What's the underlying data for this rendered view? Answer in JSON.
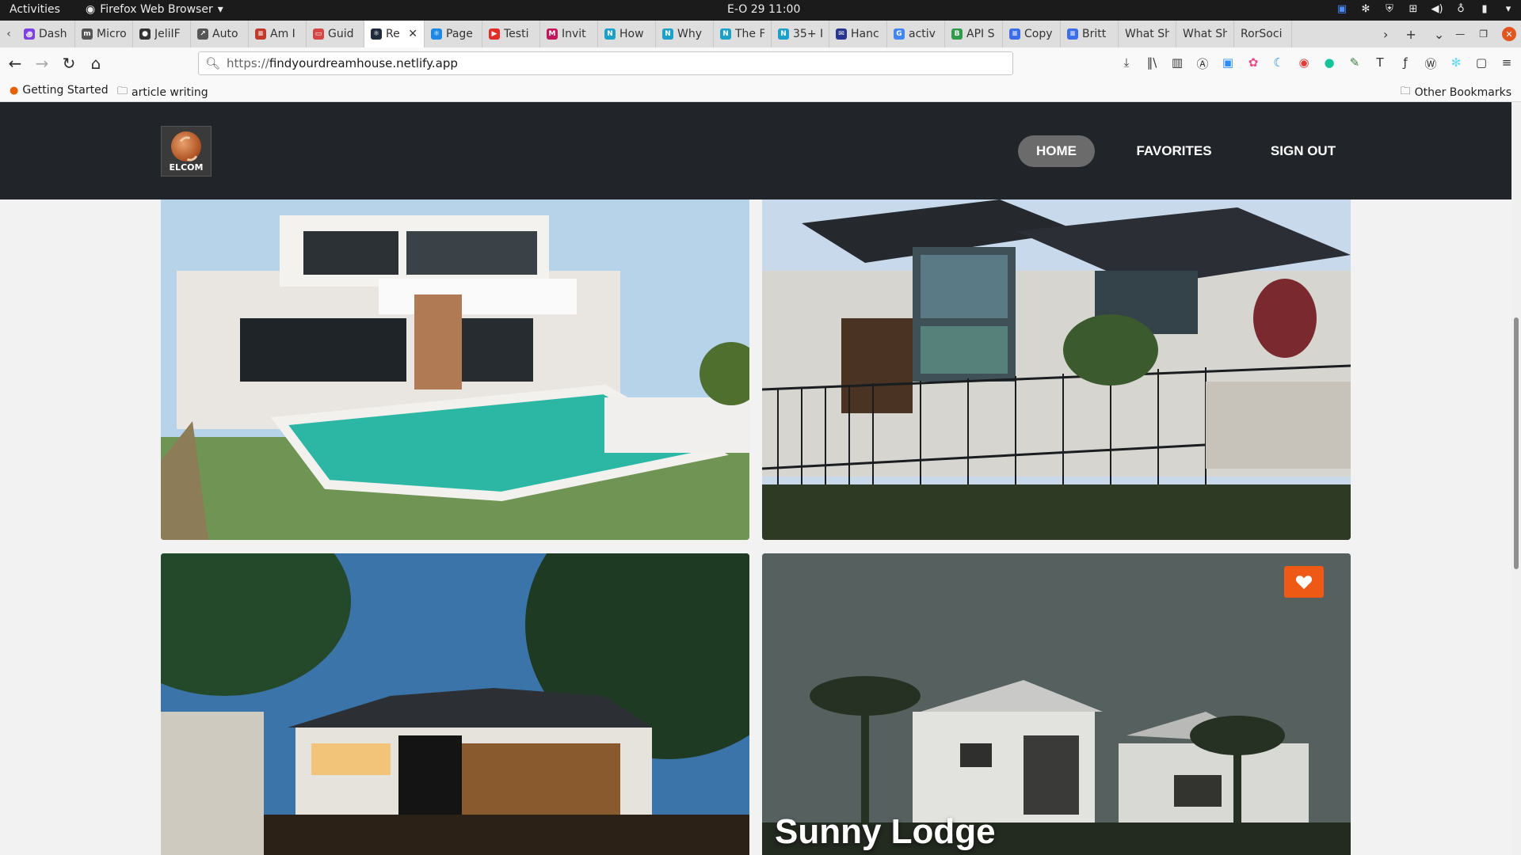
{
  "system_bar": {
    "activities": "Activities",
    "app_name": "Firefox Web Browser",
    "clock": "E-O 29  11:00"
  },
  "tabs": [
    {
      "title": "Dash",
      "color": "#7b3fe4",
      "glyph": "꩜"
    },
    {
      "title": "Micro",
      "color": "#555555",
      "glyph": "m"
    },
    {
      "title": "JeliIF",
      "color": "#333333",
      "glyph": "●"
    },
    {
      "title": "Auto",
      "color": "#555555",
      "glyph": "↗"
    },
    {
      "title": "Am I",
      "color": "#c0392b",
      "glyph": "≡"
    },
    {
      "title": "Guid",
      "color": "#d64545",
      "glyph": "▭"
    },
    {
      "title": "Re",
      "color": "#1f2b3a",
      "glyph": "⚛",
      "active": true
    },
    {
      "title": "Page",
      "color": "#1e88e5",
      "glyph": "⚛"
    },
    {
      "title": "Testi",
      "color": "#e52d27",
      "glyph": "▶"
    },
    {
      "title": "Invit",
      "color": "#c2185b",
      "glyph": "M"
    },
    {
      "title": "How",
      "color": "#1ba0c9",
      "glyph": "N"
    },
    {
      "title": "Why",
      "color": "#1ba0c9",
      "glyph": "N"
    },
    {
      "title": "The F",
      "color": "#1ba0c9",
      "glyph": "N"
    },
    {
      "title": "35+ I",
      "color": "#1ba0c9",
      "glyph": "N"
    },
    {
      "title": "Hanc",
      "color": "#283593",
      "glyph": "✉"
    },
    {
      "title": "activ",
      "color": "#4285f4",
      "glyph": "G"
    },
    {
      "title": "API S",
      "color": "#2e9c48",
      "glyph": "B"
    },
    {
      "title": "Copy",
      "color": "#3b6ee8",
      "glyph": "≡"
    },
    {
      "title": "Britt",
      "color": "#3b6ee8",
      "glyph": "≡"
    },
    {
      "title": "What Sh",
      "color": "",
      "glyph": ""
    },
    {
      "title": "What Sh",
      "color": "",
      "glyph": ""
    },
    {
      "title": "RorSoci",
      "color": "",
      "glyph": ""
    }
  ],
  "url": {
    "scheme": "https://",
    "host": "findyourdreamhouse.netlify.app"
  },
  "bookmarks": {
    "getting_started": "Getting Started",
    "article_writing": "article writing",
    "other": "Other Bookmarks"
  },
  "site": {
    "logo_text": "ELCOM",
    "nav": {
      "home": "HOME",
      "favorites": "FAVORITES",
      "sign_out": "SIGN OUT"
    },
    "cards": [
      {
        "title": ""
      },
      {
        "title": ""
      },
      {
        "title": ""
      },
      {
        "title": "Sunny Lodge",
        "favorite": true
      }
    ],
    "accent": "#ee5a16",
    "header_bg": "#212529"
  }
}
